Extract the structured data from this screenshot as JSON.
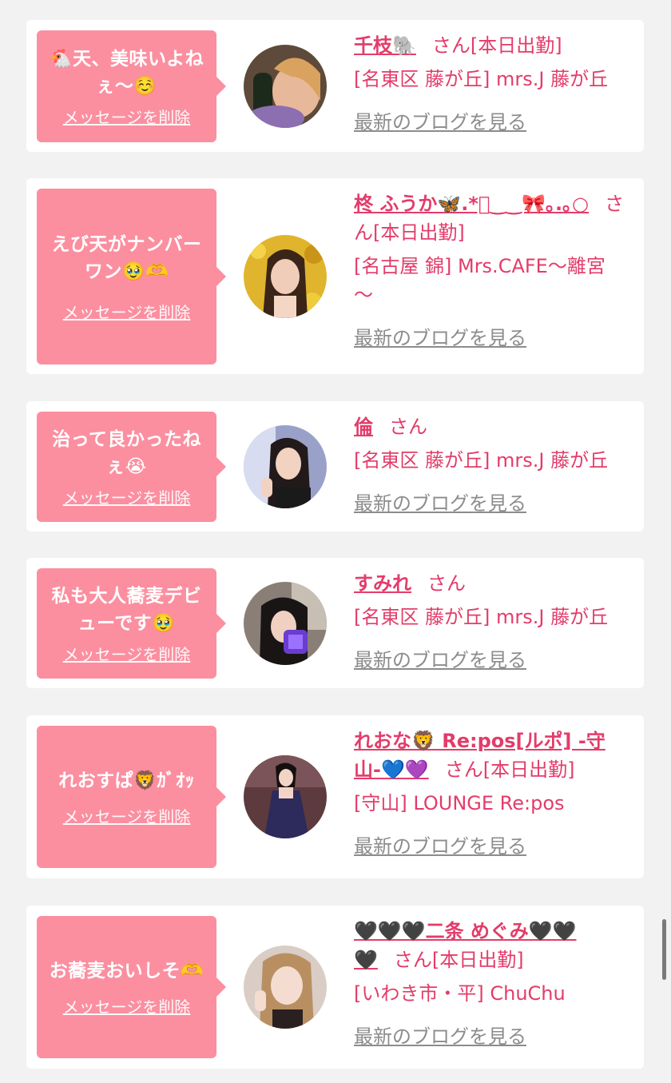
{
  "delete_label": "メッセージを削除",
  "san_label": "さん",
  "blog_label": "最新のブログを見る",
  "entries": [
    {
      "message_l1": "🐔天、美味いよね",
      "message_l2": "ぇ〜☺️",
      "name": "千枝🐘",
      "after_name": "さん[本日出勤]",
      "shop": "[名東区 藤が丘] mrs.J 藤が丘",
      "avatar_icon": "avatar-photo"
    },
    {
      "message_l1": "えび天がナンバー",
      "message_l2": "ワン🥹🫶",
      "name_l1": "柊 ふうか🦋.*ﾟ‿‿🎀｡.｡○",
      "after_name_l1": "さ",
      "after_name_l2": "ん[本日出勤]",
      "shop_l1": "[名古屋 錦] Mrs.CAFE〜離宮",
      "shop_l2": "〜",
      "avatar_icon": "avatar-photo"
    },
    {
      "message_l1": "治って良かったね",
      "message_l2": "ぇ😭",
      "name": "倫",
      "after_name": "さん",
      "shop": "[名東区 藤が丘] mrs.J 藤が丘",
      "avatar_icon": "avatar-photo"
    },
    {
      "message_l1": "私も大人蕎麦デビ",
      "message_l2": "ューです🥹",
      "name": "すみれ",
      "after_name": "さん",
      "shop": "[名東区 藤が丘] mrs.J 藤が丘",
      "avatar_icon": "avatar-photo"
    },
    {
      "message_l1": "れおすぱ🦁ｶﾞｵｯ",
      "name_l1": "れおな🦁 Re:pos[ルポ] -守",
      "name_l2": "山-💙💜",
      "after_name": "さん[本日出勤]",
      "shop": "[守山] LOUNGE Re:pos",
      "avatar_icon": "avatar-photo"
    },
    {
      "message_l1": "お蕎麦おいしそ🫶",
      "name_l1": "🖤🖤🖤二条 めぐみ🖤🖤",
      "name_l2": "🖤",
      "after_name": "さん[本日出勤]",
      "shop": "[いわき市・平] ChuChu",
      "avatar_icon": "avatar-photo"
    }
  ]
}
